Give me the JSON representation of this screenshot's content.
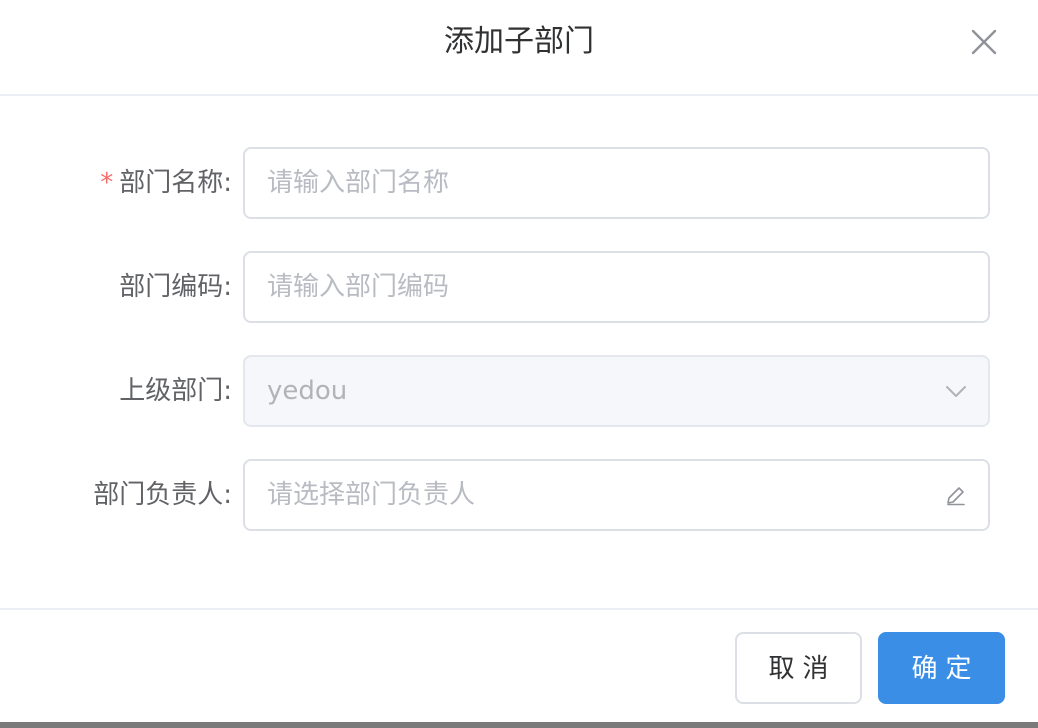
{
  "dialog": {
    "title": "添加子部门",
    "close_icon": "close-icon"
  },
  "form": {
    "dept_name": {
      "required_mark": "*",
      "label": "部门名称:",
      "value": "",
      "placeholder": "请输入部门名称"
    },
    "dept_code": {
      "label": "部门编码:",
      "value": "",
      "placeholder": "请输入部门编码"
    },
    "parent_dept": {
      "label": "上级部门:",
      "value": "yedou",
      "disabled": true,
      "suffix_icon": "chevron-down-icon"
    },
    "dept_leader": {
      "label": "部门负责人:",
      "value": "",
      "placeholder": "请选择部门负责人",
      "suffix_icon": "edit-icon"
    }
  },
  "footer": {
    "cancel_label": "取消",
    "ok_label": "确定"
  },
  "colors": {
    "primary": "#3a8ee6",
    "required": "#f56c6c",
    "border": "#dcdfe6",
    "disabled_bg": "#f5f7fa"
  }
}
